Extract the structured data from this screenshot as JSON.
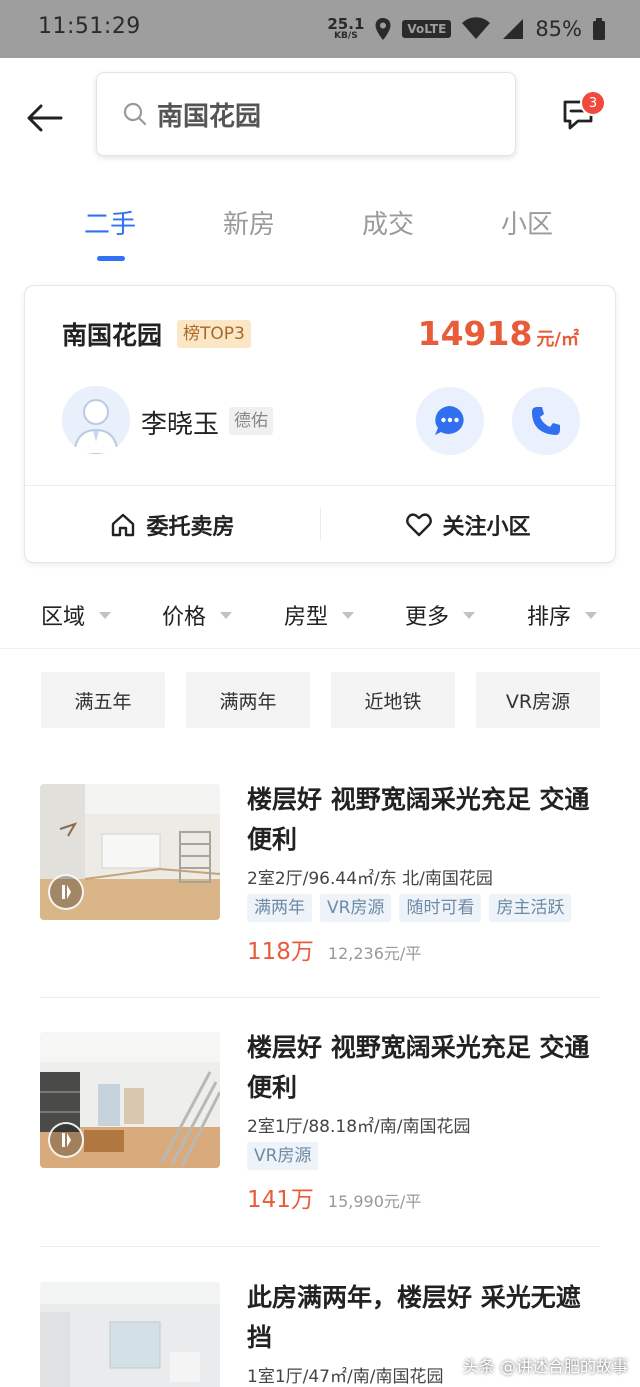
{
  "status_bar": {
    "time": "11:51:29",
    "net_speed": "25.1",
    "net_unit": "KB/S",
    "volte": "VoLTE",
    "battery": "85%"
  },
  "header": {
    "search_text": "南国花园",
    "message_badge": "3"
  },
  "tabs": [
    {
      "label": "二手",
      "active": true
    },
    {
      "label": "新房",
      "active": false
    },
    {
      "label": "成交",
      "active": false
    },
    {
      "label": "小区",
      "active": false
    }
  ],
  "community": {
    "name": "南国花园",
    "rank_tag": "榜TOP3",
    "price": "14918",
    "price_unit": "元/㎡",
    "agent_name": "李晓玉",
    "agency": "德佑",
    "action_sell": "委托卖房",
    "action_follow": "关注小区"
  },
  "filters": [
    "区域",
    "价格",
    "房型",
    "更多",
    "排序"
  ],
  "quick_tags": [
    "满五年",
    "满两年",
    "近地铁",
    "VR房源"
  ],
  "listings": [
    {
      "title": "楼层好 视野宽阔采光充足 交通便利",
      "info": "2室2厅/96.44㎡/东 北/南国花园",
      "tags": [
        "满两年",
        "VR房源",
        "随时可看",
        "房主活跃"
      ],
      "total_price": "118万",
      "unit_price": "12,236元/平"
    },
    {
      "title": "楼层好 视野宽阔采光充足 交通便利",
      "info": "2室1厅/88.18㎡/南/南国花园",
      "tags": [
        "VR房源"
      ],
      "total_price": "141万",
      "unit_price": "15,990元/平"
    },
    {
      "title": "此房满两年，楼层好 采光无遮挡",
      "info": "1室1厅/47㎡/南/南国花园",
      "tags": [],
      "total_price": "",
      "unit_price": ""
    }
  ],
  "watermark": "头条 @讲述合肥的故事",
  "colors": {
    "accent_blue": "#3072f6",
    "price_red": "#e85c3a",
    "badge_red": "#f04a3e"
  }
}
